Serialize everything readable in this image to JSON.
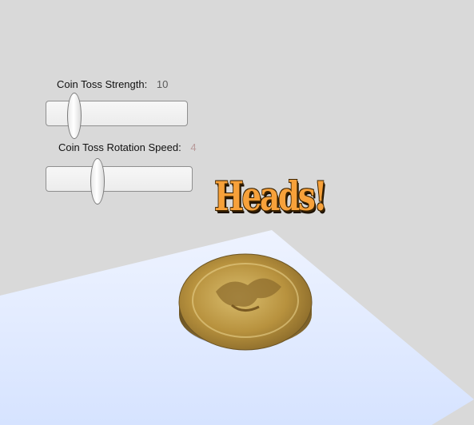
{
  "controls": {
    "strength": {
      "label": "Coin Toss Strength:",
      "value": "10",
      "level": 0.2,
      "value_color": "#5a5a5a"
    },
    "rotation": {
      "label": "Coin Toss Rotation Speed:",
      "value": "4",
      "level": 0.35,
      "value_color": "#b89a9a"
    }
  },
  "result": {
    "text": "Heads!"
  },
  "colors": {
    "background": "#d9d9d9",
    "floor": "#dfe9ff",
    "coin": "#b8923e",
    "result_text": "#f7a13a"
  },
  "icons": {
    "coin": "coin-icon"
  }
}
